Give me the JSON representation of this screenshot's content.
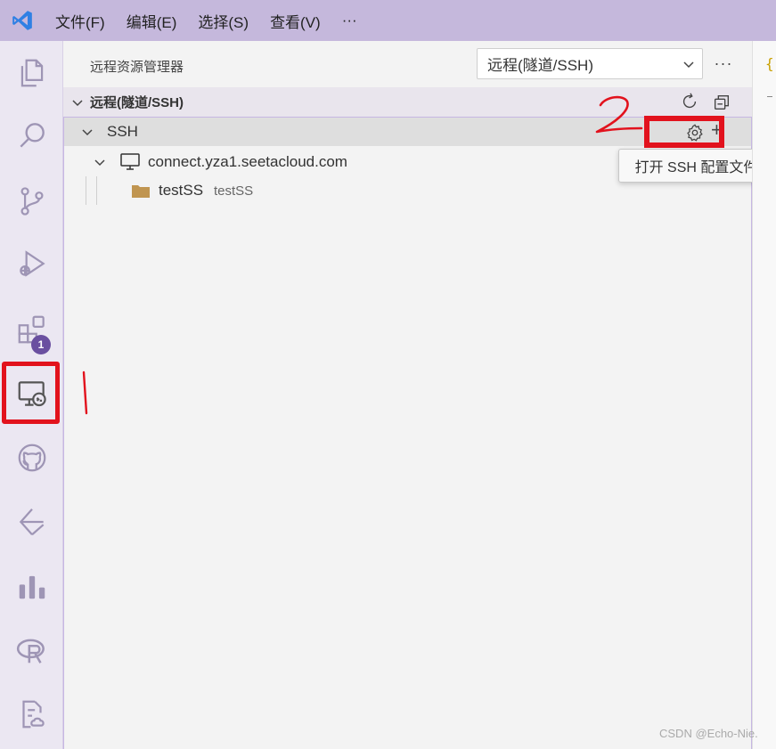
{
  "menubar": {
    "items": [
      "文件(F)",
      "编辑(E)",
      "选择(S)",
      "查看(V)",
      "···"
    ]
  },
  "activitybar": {
    "extensions_badge": "1"
  },
  "sidebar": {
    "title": "远程资源管理器",
    "dropdown_value": "远程(隧道/SSH)",
    "more": "···",
    "section_label": "远程(隧道/SSH)",
    "ssh_group": "SSH",
    "host": "connect.yza1.seetacloud.com",
    "folder_name": "testSS",
    "folder_desc": "testSS",
    "tooltip": "打开 SSH 配置文件"
  },
  "annotations": {
    "mark_1": "1",
    "mark_2": "2"
  },
  "watermark": "CSDN @Echo-Nie.",
  "colors": {
    "menubar": "#c5b8dc",
    "accent": "#6a4fa0",
    "highlight_red": "#e2121d"
  }
}
